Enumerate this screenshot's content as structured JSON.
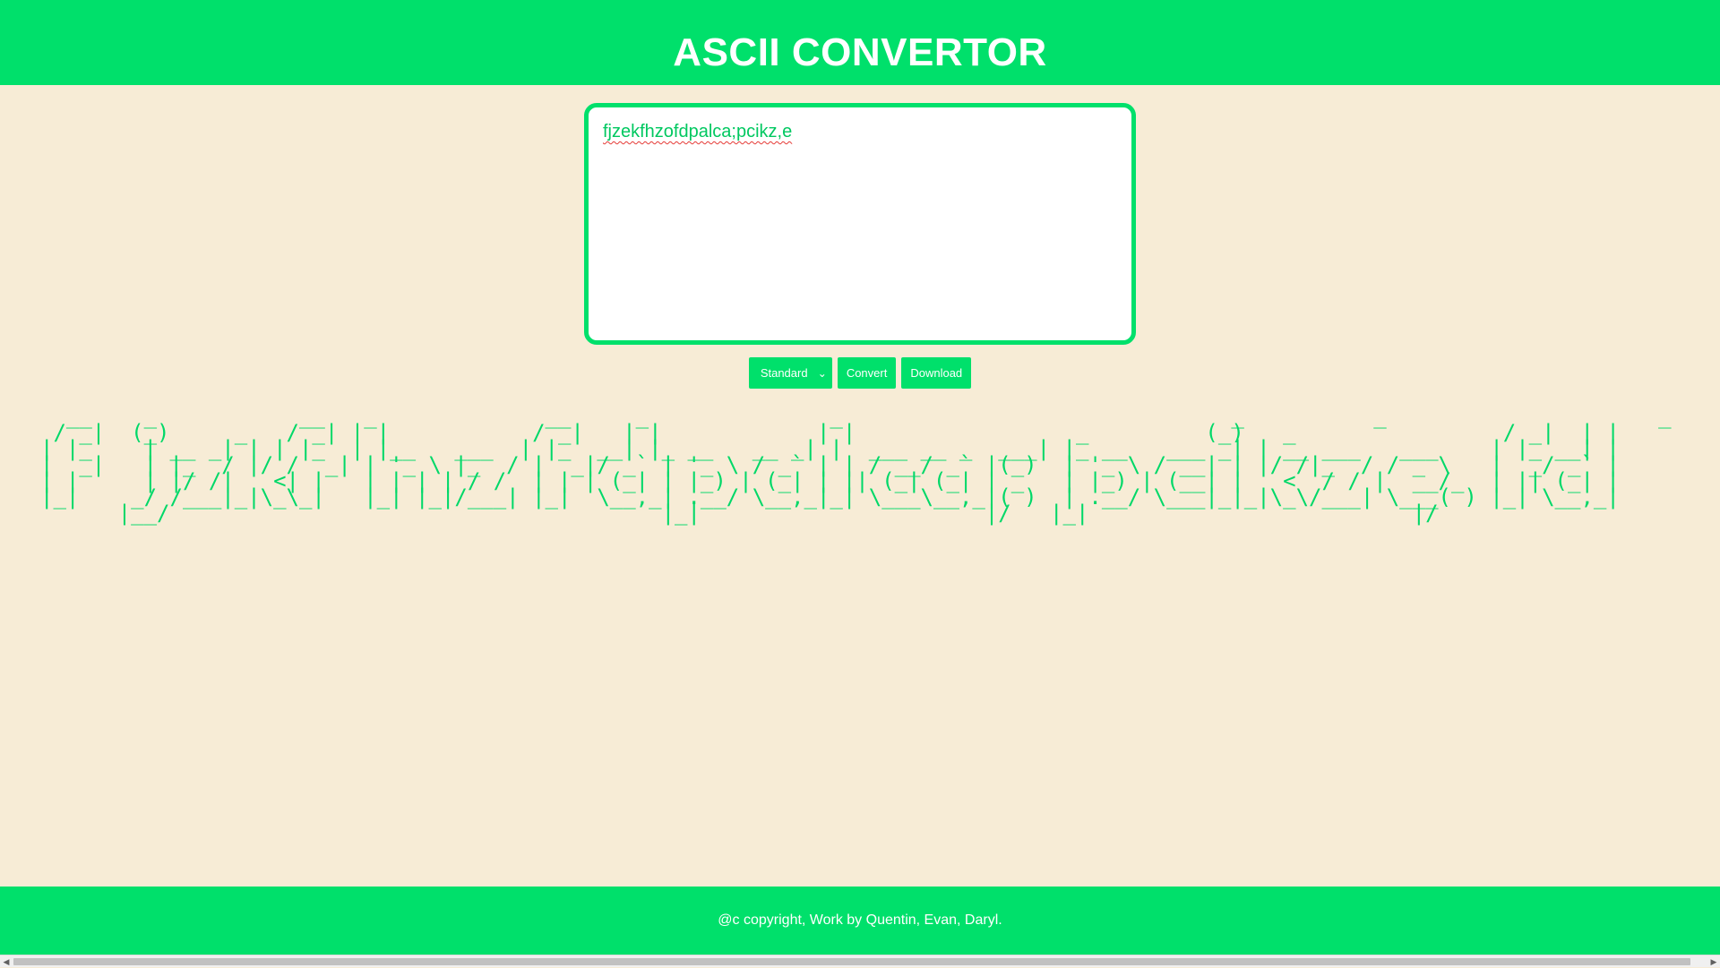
{
  "header": {
    "title": "ASCII CONVERTOR"
  },
  "editor": {
    "value": "fjzekfhzofdpalca;pcikz,e"
  },
  "controls": {
    "font_select": "Standard",
    "convert_label": "Convert",
    "download_label": "Download"
  },
  "output": {
    "ascii_art": "  __    _           __   _             __     _              _                              _          _                     _    _  \n / _|  (_)     _   / _| | |           / _|   | |            | |                 _         (_)   _                / _|  | | \n| |_    | __ _| | | |_  | |__   ___  | |_  __| |_ __   __ _| |  ___ __ _  ___| |_ __   ___ _| | __ ___   ___    | |_ __| |\n|  _|   | |_  / |/ /  _| | '_ \\ |_  / |  _|/ _` | '_ \\ / _` | | / __/ _` |(_)  | '_ \\ / __| | |/ /|_  / / _ \\   |  _/ _` |\n| |     | |/ /|   <| |   | | | | / /  | | | (_| | |_) | (_| | || (_| (_| | _   | |_) | (__| |   <  / / |  __/_  | || (_| |\n|_|    _/ /___|_|\\_\\_|   |_| |_|/___| |_|  \\__,_| .__/ \\__,_|_| \\___\\__,_|( )  | .__/ \\___|_|_|\\_\\/___| \\___( ) |_| \\__,_|\n      |__/                                      |_|                      |/   |_|                         |/             "
  },
  "footer": {
    "text": "@c copyright, Work by Quentin, Evan, Daryl."
  }
}
